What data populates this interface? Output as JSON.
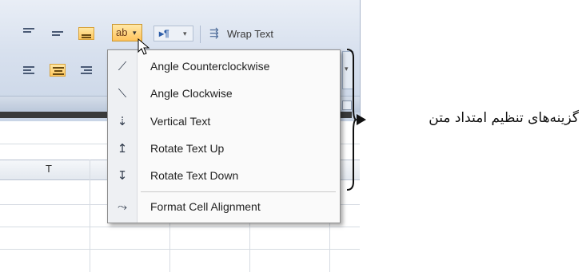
{
  "ribbon": {
    "orientation_button": {
      "icon": "angle-text-icon"
    },
    "text_direction_button": {
      "icon": "text-direction-icon"
    },
    "wrap_text_label": "Wrap Text"
  },
  "spreadsheet": {
    "column_header": "T"
  },
  "orientation_menu": {
    "items": [
      {
        "label": "Angle Counterclockwise",
        "icon": "angle-counterclockwise-icon"
      },
      {
        "label": "Angle Clockwise",
        "icon": "angle-clockwise-icon"
      },
      {
        "label": "Vertical Text",
        "icon": "vertical-text-icon"
      },
      {
        "label": "Rotate Text Up",
        "icon": "rotate-text-up-icon"
      },
      {
        "label": "Rotate Text Down",
        "icon": "rotate-text-down-icon"
      },
      {
        "label": "Format Cell Alignment",
        "icon": "format-cell-alignment-icon"
      }
    ]
  },
  "annotation": {
    "text": "گزینه‌های تنظیم امتداد متن"
  }
}
